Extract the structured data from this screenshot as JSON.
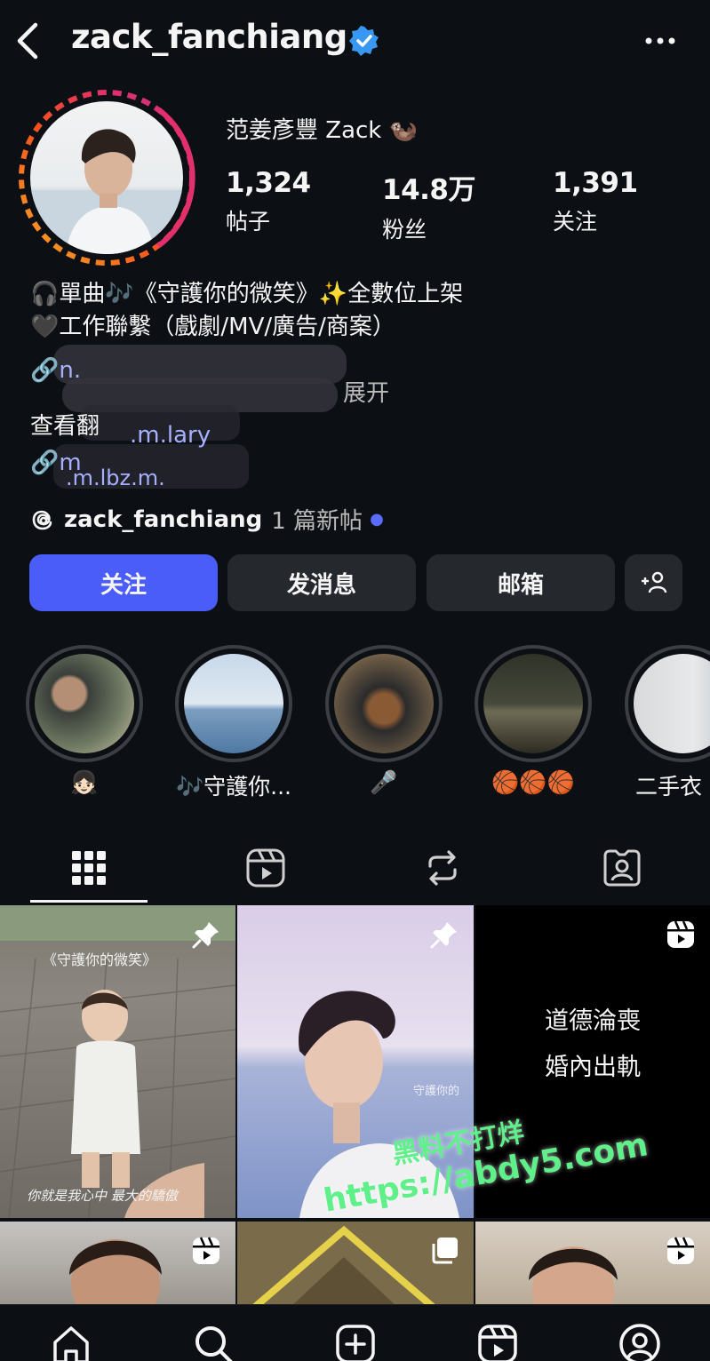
{
  "header": {
    "username": "zack_fanchiang",
    "back_icon": "chevron-left-icon",
    "verified_icon": "verified-badge-icon",
    "more_icon": "more-horizontal-icon",
    "verified_color": "#3897f0"
  },
  "profile": {
    "display_name": "范姜彥豐 Zack 🦦",
    "stats": [
      {
        "value": "1,324",
        "label": "帖子"
      },
      {
        "value": "14.8万",
        "label": "粉丝"
      },
      {
        "value": "1,391",
        "label": "关注"
      }
    ],
    "bio_lines": [
      "🎧單曲🎶《守護你的微笑》✨全數位上架",
      "🖤工作聯繫（戲劇/MV/廣告/商案）"
    ],
    "link_1": "n.",
    "expand_label": "展开",
    "see_translation": "查看翻",
    "link_fragment_1": ".m.lary",
    "link_2": "m",
    "link_fragment_2": ".m.lbz.m.",
    "threads_icon": "threads-icon",
    "threads_name": "zack_fanchiang",
    "threads_count": "1 篇新帖",
    "accent_color": "#4a5df9"
  },
  "actions": {
    "follow": "关注",
    "message": "发消息",
    "email": "邮箱",
    "add_user_icon": "add-person-icon"
  },
  "highlights": [
    {
      "label": "👧🏻"
    },
    {
      "label": "🎶守護你..."
    },
    {
      "label": "🎤"
    },
    {
      "label": "🏀🏀🏀"
    },
    {
      "label": "二手衣"
    }
  ],
  "tabs": [
    {
      "icon": "grid-icon",
      "active": true
    },
    {
      "icon": "reels-icon",
      "active": false
    },
    {
      "icon": "repost-icon",
      "active": false
    },
    {
      "icon": "tagged-icon",
      "active": false
    }
  ],
  "grid": {
    "post_1_caption": "《守護你的微笑》",
    "post_1_subtitle": "你就是我心中 最大的驕傲",
    "post_2_caption": "守護你的",
    "post_3_line_1": "道德淪喪",
    "post_3_line_2": "婚內出軌"
  },
  "watermark": {
    "line_1": "黑料不打烊",
    "line_2": "https://abdy5.com"
  },
  "nav": [
    {
      "icon": "home-icon"
    },
    {
      "icon": "search-icon"
    },
    {
      "icon": "create-icon"
    },
    {
      "icon": "reels-nav-icon"
    },
    {
      "icon": "profile-icon"
    }
  ]
}
